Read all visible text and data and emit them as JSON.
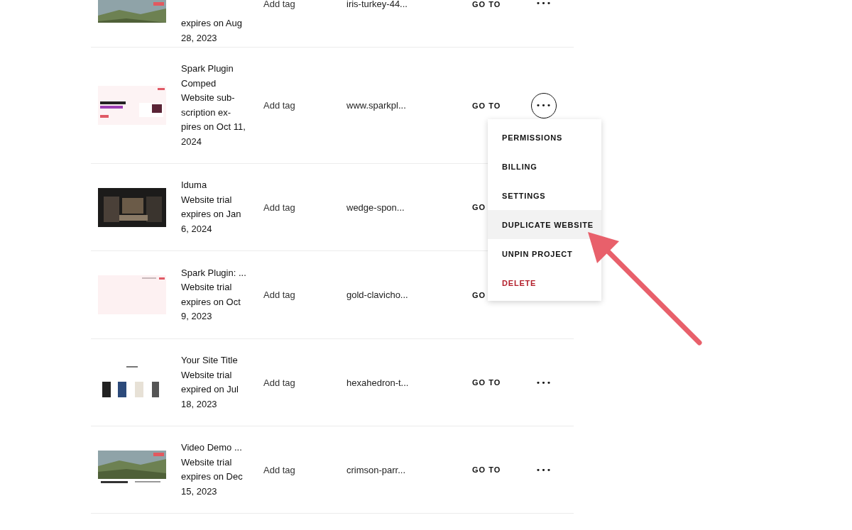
{
  "rows": [
    {
      "thumbnail": {
        "kind": "picture"
      },
      "title_lines": [],
      "status": "expires on Aug 28, 2023",
      "tag": "Add tag",
      "url": "iris-turkey-44...",
      "go_to": "GO TO",
      "more": "•••",
      "menu_open": false
    },
    {
      "thumbnail": {
        "kind": "picture"
      },
      "title_lines": [
        "Spark Plugin Comped"
      ],
      "status": "Website sub-scription ex-pires on Oct 11, 2024",
      "tag": "Add tag",
      "url": "www.sparkpl...",
      "go_to": "GO TO",
      "more": "•••",
      "menu_open": true
    },
    {
      "thumbnail": {
        "kind": "picture"
      },
      "title_lines": [
        "Iduma"
      ],
      "status": "Website trial expires on Jan 6, 2024",
      "tag": "Add tag",
      "url": "wedge-spon...",
      "go_to": "GO",
      "more": "",
      "menu_open": false
    },
    {
      "thumbnail": {
        "kind": "picture"
      },
      "title_lines": [
        "Spark Plugin: ..."
      ],
      "status": "Website trial expires on Oct 9, 2023",
      "tag": "Add tag",
      "url": "gold-clavicho...",
      "go_to": "GO",
      "more": "",
      "menu_open": false
    },
    {
      "thumbnail": {
        "kind": "picture"
      },
      "title_lines": [
        "Your Site Title"
      ],
      "status": "Website trial expired on Jul 18, 2023",
      "tag": "Add tag",
      "url": "hexahedron-t...",
      "go_to": "GO TO",
      "more": "•••",
      "menu_open": false
    },
    {
      "thumbnail": {
        "kind": "picture"
      },
      "title_lines": [
        "Video Demo ..."
      ],
      "status": "Website trial expires on Dec 15, 2023",
      "tag": "Add tag",
      "url": "crimson-parr...",
      "go_to": "GO TO",
      "more": "•••",
      "menu_open": false
    }
  ],
  "menu": {
    "items": [
      {
        "label": "PERMISSIONS",
        "selected": false,
        "kind": "normal"
      },
      {
        "label": "BILLING",
        "selected": false,
        "kind": "normal"
      },
      {
        "label": "SETTINGS",
        "selected": false,
        "kind": "normal"
      },
      {
        "label": "DUPLICATE WEBSITE",
        "selected": true,
        "kind": "normal"
      },
      {
        "label": "UNPIN PROJECT",
        "selected": false,
        "kind": "normal"
      },
      {
        "label": "DELETE",
        "selected": false,
        "kind": "danger"
      }
    ]
  }
}
